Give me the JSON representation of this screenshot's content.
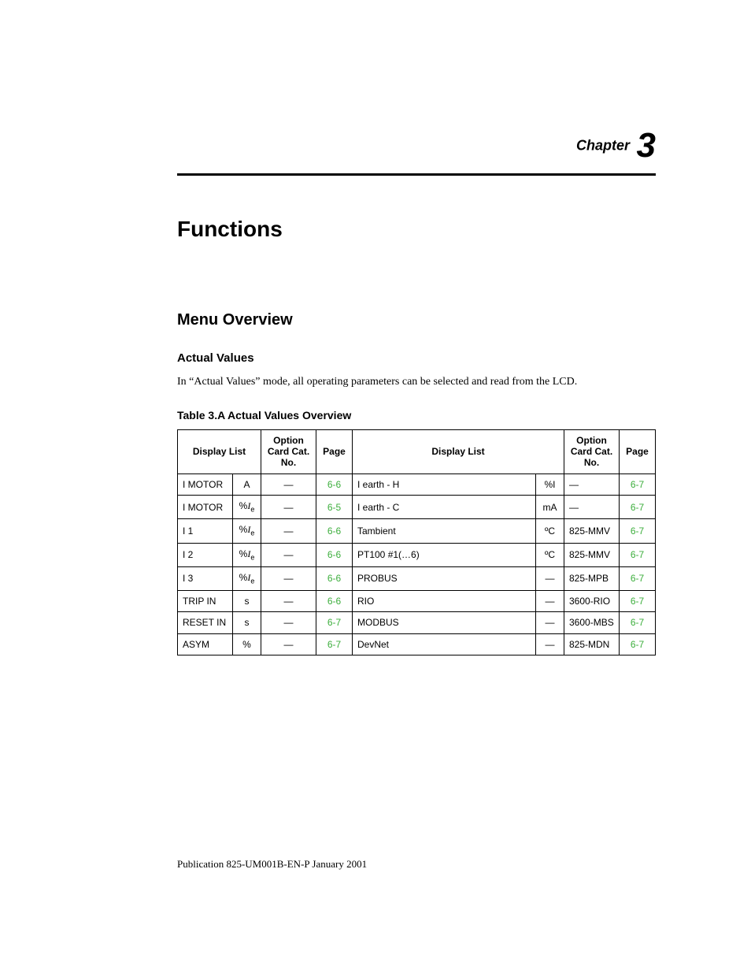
{
  "chapter": {
    "label": "Chapter",
    "number": "3"
  },
  "title": "Functions",
  "section": "Menu Overview",
  "subsection": "Actual Values",
  "intro": "In “Actual Values” mode, all operating parameters can be selected and read from the LCD.",
  "table_caption": "Table 3.A Actual Values Overview",
  "headers": {
    "display_list": "Display List",
    "option_card": "Option Card Cat. No.",
    "page": "Page"
  },
  "rows_left": [
    {
      "name": "I MOTOR",
      "unit": "A",
      "opt": "—",
      "page": "6-6"
    },
    {
      "name": "I MOTOR",
      "unit": "%Ie",
      "opt": "—",
      "page": "6-5"
    },
    {
      "name": "I 1",
      "unit": "%Ie",
      "opt": "—",
      "page": "6-6"
    },
    {
      "name": "I 2",
      "unit": "%Ie",
      "opt": "—",
      "page": "6-6"
    },
    {
      "name": "I 3",
      "unit": "%Ie",
      "opt": "—",
      "page": "6-6"
    },
    {
      "name": "TRIP IN",
      "unit": "s",
      "opt": "—",
      "page": "6-6"
    },
    {
      "name": "RESET IN",
      "unit": "s",
      "opt": "—",
      "page": "6-7"
    },
    {
      "name": "ASYM",
      "unit": "%",
      "opt": "—",
      "page": "6-7"
    }
  ],
  "rows_right": [
    {
      "name": "I earth - H",
      "unit": "%I",
      "opt": "—",
      "page": "6-7"
    },
    {
      "name": "I earth - C",
      "unit": "mA",
      "opt": "—",
      "page": "6-7"
    },
    {
      "name": "Tambient",
      "unit": "ºC",
      "opt": "825-MMV",
      "page": "6-7"
    },
    {
      "name": "PT100 #1(…6)",
      "unit": "ºC",
      "opt": "825-MMV",
      "page": "6-7"
    },
    {
      "name": "PROBUS",
      "unit": "—",
      "opt": "825-MPB",
      "page": "6-7"
    },
    {
      "name": "RIO",
      "unit": "—",
      "opt": "3600-RIO",
      "page": "6-7"
    },
    {
      "name": "MODBUS",
      "unit": "—",
      "opt": "3600-MBS",
      "page": "6-7"
    },
    {
      "name": "DevNet",
      "unit": "—",
      "opt": "825-MDN",
      "page": "6-7"
    }
  ],
  "footer": "Publication 825-UM001B-EN-P  January 2001"
}
